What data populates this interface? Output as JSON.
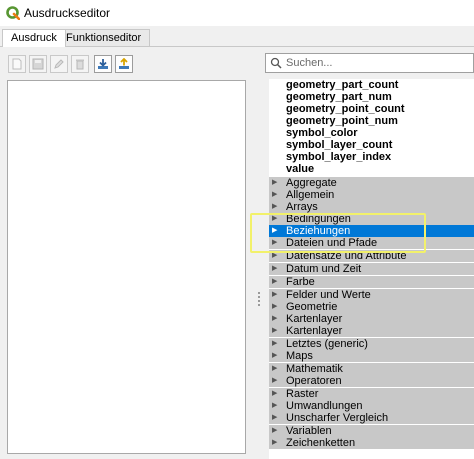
{
  "window": {
    "title": "Ausdruckseditor"
  },
  "tabs": [
    {
      "label": "Ausdruck",
      "active": true
    },
    {
      "label": "Funktionseditor",
      "active": false
    }
  ],
  "search": {
    "placeholder": "Suchen...",
    "value": ""
  },
  "functions": [
    "geometry_part_count",
    "geometry_part_num",
    "geometry_point_count",
    "geometry_point_num",
    "symbol_color",
    "symbol_layer_count",
    "symbol_layer_index",
    "value"
  ],
  "groups": [
    "Aggregate",
    "Allgemein",
    "Arrays",
    "Bedingungen",
    "Beziehungen",
    "Dateien und Pfade",
    "Datensätze und Attribute",
    "Datum und Zeit",
    "Farbe",
    "Felder und Werte",
    "Geometrie",
    "Kartenlayer",
    "Kartenlayer",
    "Letztes (generic)",
    "Maps",
    "Mathematik",
    "Operatoren",
    "Raster",
    "Umwandlungen",
    "Unscharfer Vergleich",
    "Variablen",
    "Zeichenketten"
  ],
  "selected_group": "Beziehungen",
  "colors": {
    "selection": "#0078d7",
    "group_bg": "#c8c8c8",
    "highlight": "#f2f16a",
    "qgis_green": "#589632"
  },
  "toolbar_icons": [
    "new-file-icon",
    "save-icon",
    "edit-icon",
    "delete-icon",
    "import-icon",
    "export-icon"
  ]
}
